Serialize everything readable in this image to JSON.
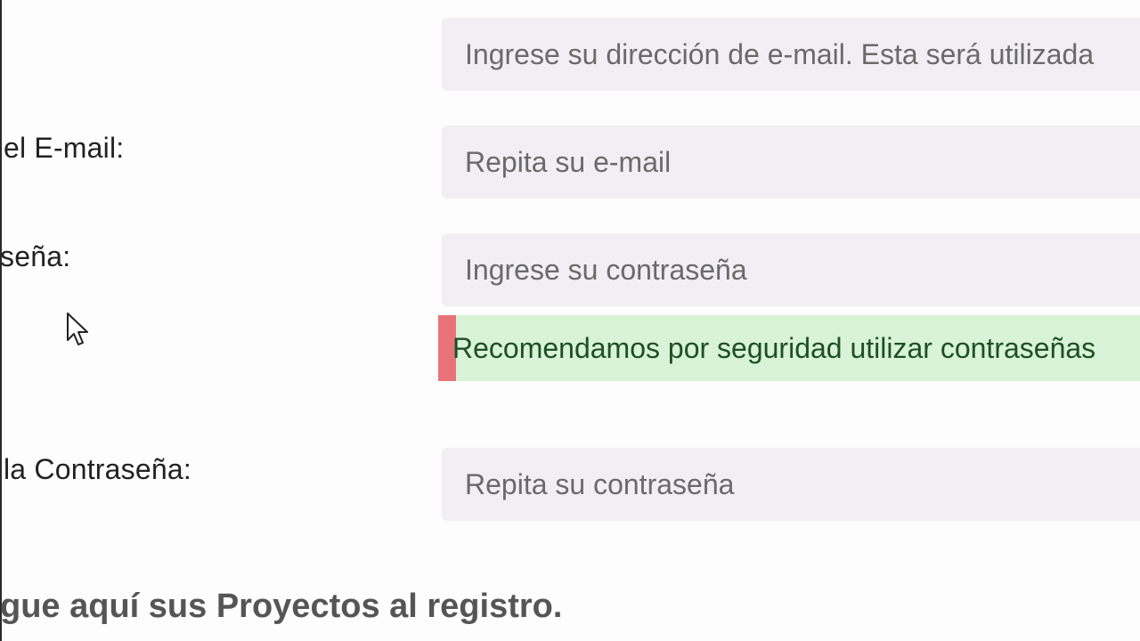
{
  "form": {
    "email": {
      "placeholder": "Ingrese su dirección de e-mail. Esta será utilizada"
    },
    "email_confirm": {
      "label": "el E-mail:",
      "placeholder": "Repita su e-mail"
    },
    "password": {
      "label": "seña:",
      "placeholder": "Ingrese su contraseña"
    },
    "password_hint": {
      "text": "Recomendamos por seguridad utilizar contraseñas",
      "accent_color": "#e8747a",
      "background_color": "#d8f3d6"
    },
    "password_confirm": {
      "label": "la Contraseña:",
      "placeholder": "Repita su contraseña"
    }
  },
  "section": {
    "title": "gue aquí sus Proyectos al registro."
  },
  "pointer": {
    "icon": "arrow-cursor-icon"
  }
}
